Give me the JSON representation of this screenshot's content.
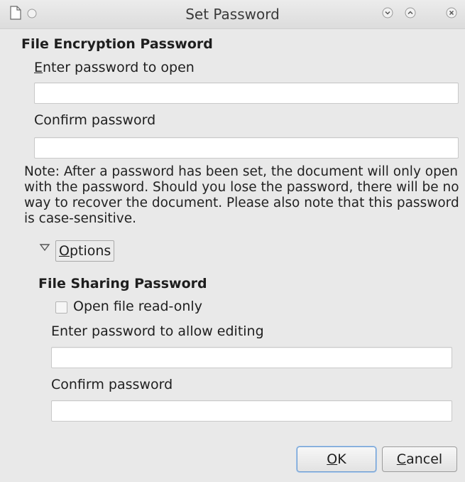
{
  "window": {
    "title": "Set Password"
  },
  "encryption": {
    "section_title": "File Encryption Password",
    "enter_label": "Enter password to open",
    "enter_value": "",
    "confirm_label": "Confirm password",
    "confirm_value": "",
    "note": "Note: After a password has been set, the document will only open with the password. Should you lose the password, there will be no way to recover the document. Please also note that this password is case-sensitive."
  },
  "options": {
    "label": "Options",
    "expanded": true
  },
  "sharing": {
    "section_title": "File Sharing Password",
    "readonly_label": "Open file read-only",
    "readonly_checked": false,
    "edit_label": "Enter password to allow editing",
    "edit_value": "",
    "confirm_label": "Confirm password",
    "confirm_value": ""
  },
  "buttons": {
    "ok": "OK",
    "cancel": "Cancel"
  },
  "icons": {
    "window_icon": "document-icon",
    "menu": "circle-icon",
    "minimize": "chevron-down-icon",
    "maximize": "chevron-up-icon",
    "close": "close-icon",
    "options_toggle": "triangle-down-icon"
  }
}
